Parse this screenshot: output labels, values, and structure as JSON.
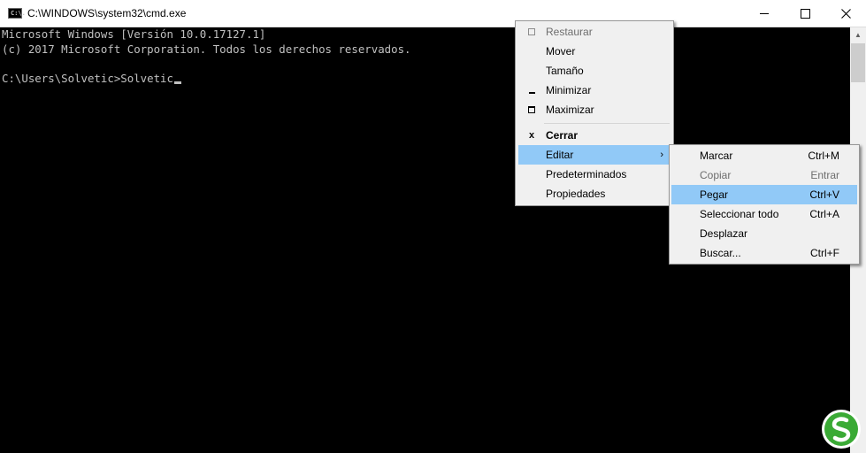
{
  "window": {
    "title": "C:\\WINDOWS\\system32\\cmd.exe",
    "icon": "cmd-app-icon",
    "icon_text": "C:\\."
  },
  "console": {
    "lines": [
      "Microsoft Windows [Versión 10.0.17127.1]",
      "(c) 2017 Microsoft Corporation. Todos los derechos reservados.",
      "",
      "C:\\Users\\Solvetic>Solvetic"
    ]
  },
  "system_menu": {
    "items": [
      {
        "label": "Restaurar",
        "icon": "restore-icon",
        "disabled": true
      },
      {
        "label": "Mover"
      },
      {
        "label": "Tamaño"
      },
      {
        "label": "Minimizar",
        "icon": "minimize-icon"
      },
      {
        "label": "Maximizar",
        "icon": "maximize-icon"
      },
      {
        "label": "Cerrar",
        "icon": "close-icon",
        "icon_text": "x",
        "bold": true
      },
      {
        "label": "Editar",
        "highlighted": true,
        "submenu_arrow": "›"
      },
      {
        "label": "Predeterminados"
      },
      {
        "label": "Propiedades"
      }
    ]
  },
  "edit_submenu": {
    "items": [
      {
        "label": "Marcar",
        "shortcut": "Ctrl+M"
      },
      {
        "label": "Copiar",
        "shortcut": "Entrar",
        "disabled": true
      },
      {
        "label": "Pegar",
        "shortcut": "Ctrl+V",
        "highlighted": true
      },
      {
        "label": "Seleccionar todo",
        "shortcut": "Ctrl+A"
      },
      {
        "label": "Desplazar",
        "shortcut": ""
      },
      {
        "label": "Buscar...",
        "shortcut": "Ctrl+F"
      }
    ]
  },
  "colors": {
    "console_bg": "#000000",
    "console_text": "#c0c0c0",
    "menu_bg": "#f0f0f0",
    "highlight": "#91c9f7",
    "logo_green": "#3aaa35"
  }
}
